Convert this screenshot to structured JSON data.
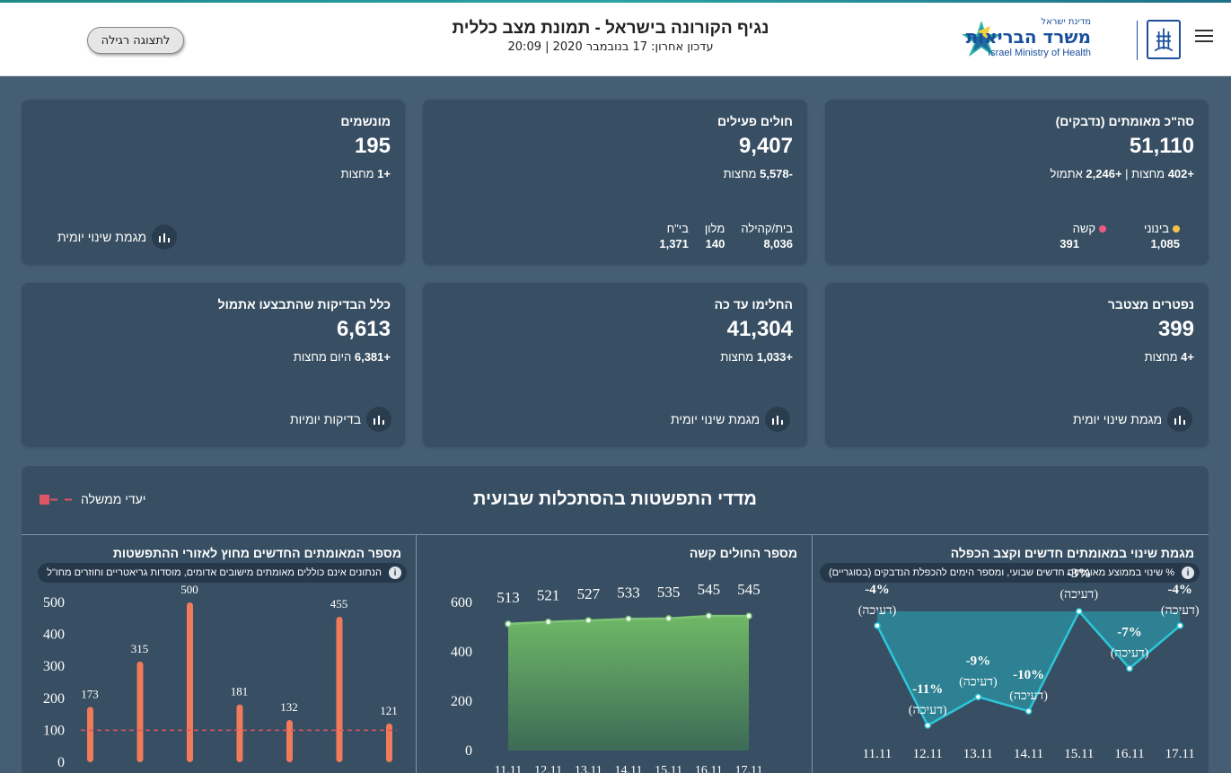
{
  "header": {
    "title": "נגיף הקורונה בישראל - תמונת מצב כללית",
    "updated": "עדכון אחרון: 17 בנובמבר 2020  |  20:09",
    "toggle_label": "לתצוגה רגילה",
    "logo": {
      "small": "מדינת ישראל",
      "main": "משרד הבריאות",
      "english": "Israel Ministry of Health"
    }
  },
  "cards": {
    "confirmed": {
      "title": "סה\"כ מאומתים (נדבקים)",
      "value": "51,110",
      "delta1": "+402",
      "delta1_label": " מחצות | ",
      "delta2": "+2,246",
      "delta2_label": " אתמול",
      "mild_label": "בינוני",
      "mild_value": "1,085",
      "severe_label": "קשה",
      "severe_value": "391"
    },
    "active": {
      "title": "חולים פעילים",
      "value": "9,407",
      "delta": "-5,578",
      "delta_label": " מחצות",
      "home_label": "בית/קהילה",
      "home_value": "8,036",
      "hotel_label": "מלון",
      "hotel_value": "140",
      "hospital_label": "בי\"ח",
      "hospital_value": "1,371"
    },
    "ventilated": {
      "title": "מונשמים",
      "value": "195",
      "delta": "+1",
      "delta_label": " מחצות",
      "link": "מגמת שינוי יומית"
    },
    "deceased": {
      "title": "נפטרים מצטבר",
      "value": "399",
      "delta": "+4",
      "delta_label": " מחצות",
      "link": "מגמת שינוי יומית"
    },
    "recovered": {
      "title": "החלימו עד כה",
      "value": "41,304",
      "delta": "+1,033",
      "delta_label": " מחצות",
      "link": "מגמת שינוי יומית"
    },
    "tests": {
      "title": "כלל הבדיקות שהתבצעו אתמול",
      "value": "6,613",
      "delta": "+6,381",
      "delta_label": " היום מחצות",
      "link": "בדיקות יומיות"
    }
  },
  "spread_panel": {
    "title": "מדדי התפשטות בהסתכלות שבועית",
    "legend": "יעדי ממשלה",
    "colors": {
      "panel": "#384f63",
      "severe_line": "#7cc576",
      "trend_line": "#2cc6d8",
      "bars": "#f07a5a",
      "target": "#e05563"
    }
  },
  "chart_data": [
    {
      "type": "line",
      "title": "מגמת שינוי במאומתים חדשים וקצב הכפלה",
      "note": "% שינוי בממוצע מאומתים חדשים שבועי, ומספר הימים להכפלת הנדבקים (בסוגריים)",
      "x": [
        "11.11",
        "12.11",
        "13.11",
        "14.11",
        "15.11",
        "16.11",
        "17.11"
      ],
      "values": [
        -4,
        -11,
        -9,
        -10,
        -3,
        -7,
        -4
      ],
      "value_labels": [
        "-4%",
        "-11%",
        "-9%",
        "-10%",
        "-3%",
        "-7%",
        "-4%"
      ],
      "sub_labels": [
        "(דעיכה)",
        "(דעיכה)",
        "(דעיכה)",
        "(דעיכה)",
        "(דעיכה)",
        "(דעיכה)",
        "(דעיכה)"
      ]
    },
    {
      "type": "area",
      "title": "מספר החולים קשה",
      "x": [
        "11.11",
        "12.11",
        "13.11",
        "14.11",
        "15.11",
        "16.11",
        "17.11"
      ],
      "values": [
        513,
        521,
        527,
        533,
        535,
        545,
        545
      ],
      "yticks": [
        0,
        200,
        400,
        600
      ],
      "ylim": [
        0,
        600
      ]
    },
    {
      "type": "bar",
      "title": "מספר המאומתים החדשים מחוץ לאזורי ההתפשטות",
      "note": "הנתונים אינם כוללים מאומתים מישובים אדומים, מוסדות גריאטריים וחוזרים מחו\"ל",
      "values": [
        173,
        315,
        500,
        181,
        132,
        455,
        121
      ],
      "target": 100,
      "yticks": [
        0,
        100,
        200,
        300,
        400,
        500
      ],
      "ylim": [
        0,
        500
      ]
    }
  ]
}
